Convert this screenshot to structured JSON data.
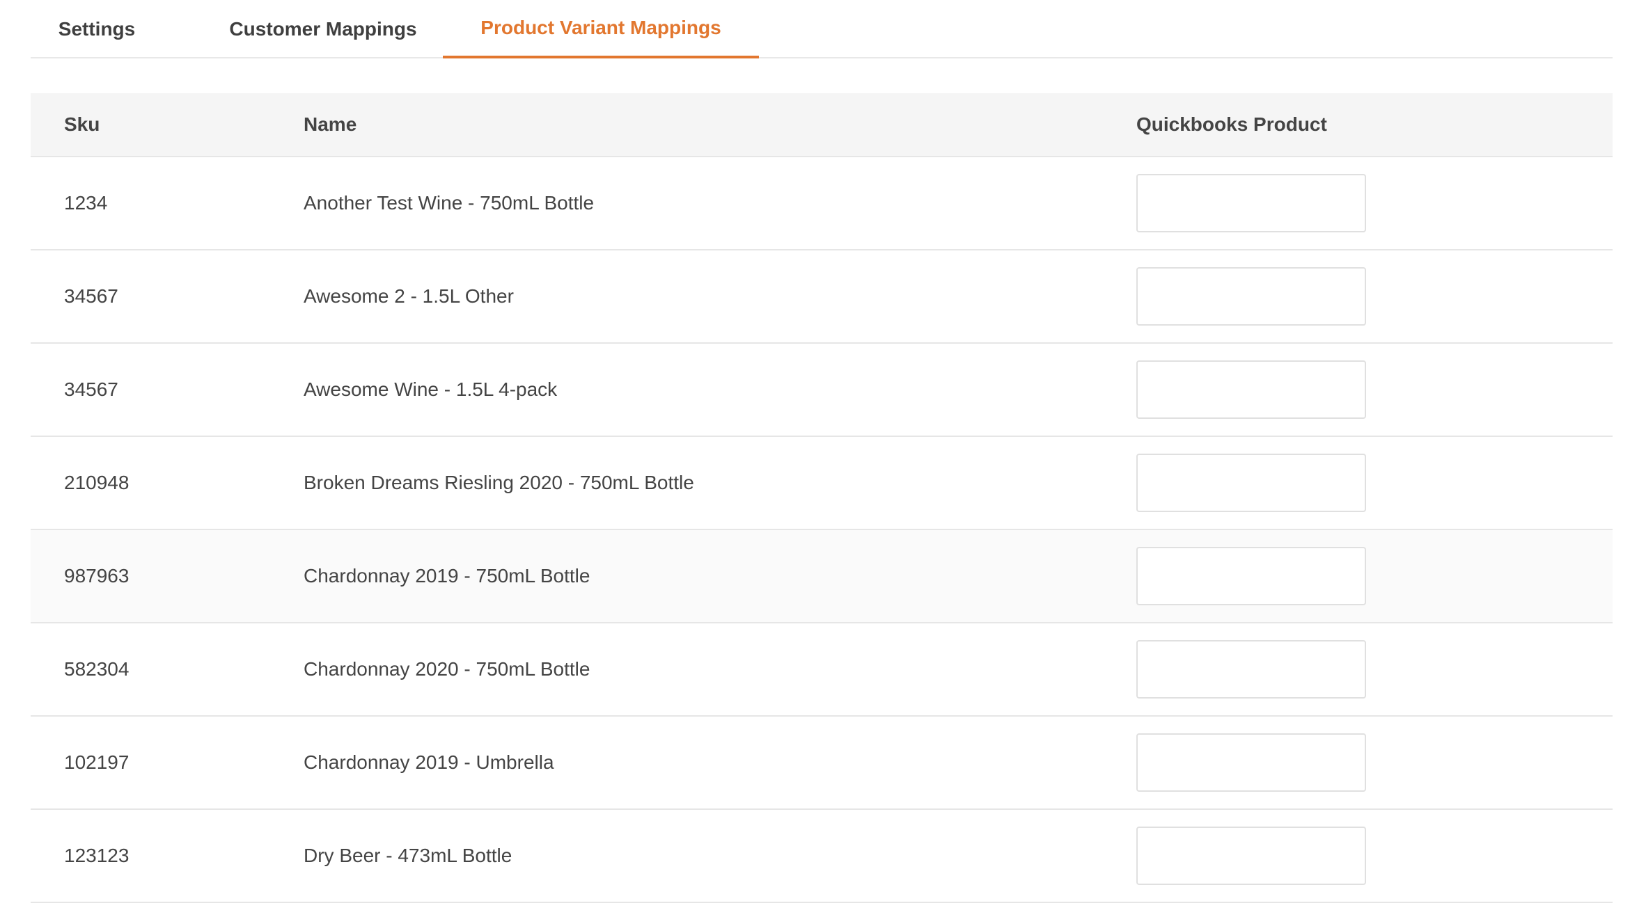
{
  "tabs": [
    {
      "label": "Settings",
      "active": false
    },
    {
      "label": "Customer Mappings",
      "active": false
    },
    {
      "label": "Product Variant Mappings",
      "active": true
    }
  ],
  "colors": {
    "accent": "#e2772f",
    "header_bg": "#f5f5f5",
    "border": "#e6e6e6"
  },
  "table": {
    "headers": {
      "sku": "Sku",
      "name": "Name",
      "quickbooks_product": "Quickbooks Product"
    },
    "rows": [
      {
        "sku": "1234",
        "name": "Another Test Wine - 750mL Bottle",
        "quickbooks_product": ""
      },
      {
        "sku": "34567",
        "name": "Awesome 2 - 1.5L Other",
        "quickbooks_product": ""
      },
      {
        "sku": "34567",
        "name": "Awesome Wine - 1.5L 4-pack",
        "quickbooks_product": ""
      },
      {
        "sku": "210948",
        "name": "Broken Dreams Riesling 2020 - 750mL Bottle",
        "quickbooks_product": ""
      },
      {
        "sku": "987963",
        "name": "Chardonnay 2019 - 750mL Bottle",
        "quickbooks_product": ""
      },
      {
        "sku": "582304",
        "name": "Chardonnay 2020 - 750mL Bottle",
        "quickbooks_product": ""
      },
      {
        "sku": "102197",
        "name": "Chardonnay 2019 - Umbrella",
        "quickbooks_product": ""
      },
      {
        "sku": "123123",
        "name": "Dry Beer - 473mL Bottle",
        "quickbooks_product": ""
      }
    ]
  }
}
